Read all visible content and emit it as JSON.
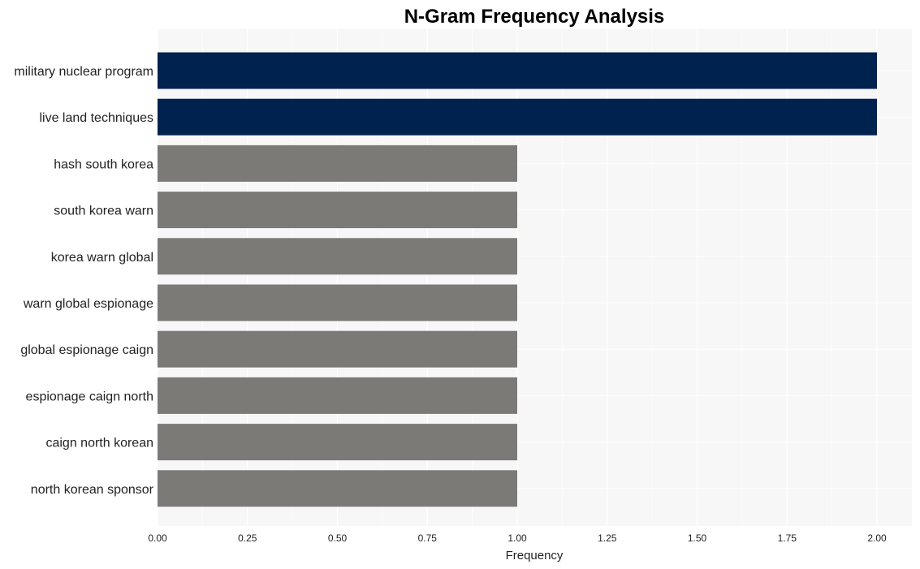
{
  "chart_data": {
    "type": "bar",
    "orientation": "horizontal",
    "title": "N-Gram Frequency Analysis",
    "xlabel": "Frequency",
    "ylabel": "",
    "categories": [
      "military nuclear program",
      "live land techniques",
      "hash south korea",
      "south korea warn",
      "korea warn global",
      "warn global espionage",
      "global espionage caign",
      "espionage caign north",
      "caign north korean",
      "north korean sponsor"
    ],
    "values": [
      2,
      2,
      1,
      1,
      1,
      1,
      1,
      1,
      1,
      1
    ],
    "xlim": [
      0,
      2.1
    ],
    "xticks": [
      0.0,
      0.25,
      0.5,
      0.75,
      1.0,
      1.25,
      1.5,
      1.75,
      2.0
    ],
    "xtick_labels": [
      "0.00",
      "0.25",
      "0.50",
      "0.75",
      "1.00",
      "1.25",
      "1.50",
      "1.75",
      "2.00"
    ],
    "grid": true,
    "colors": {
      "highlight": "#00224e",
      "default": "#7b7a76",
      "panel_background": "#f7f7f7",
      "grid": "#ffffff"
    },
    "highlight_threshold": 2
  }
}
